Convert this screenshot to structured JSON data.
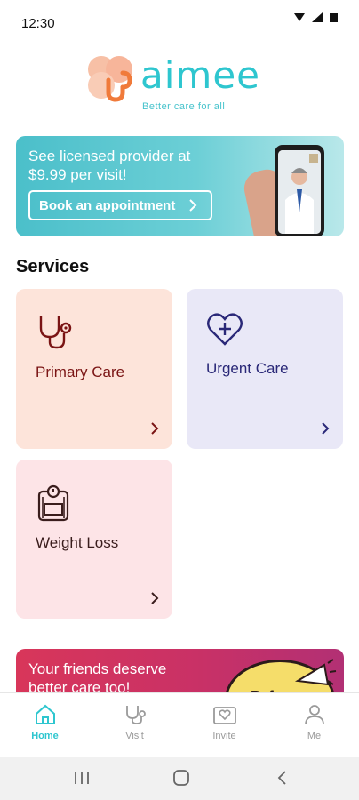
{
  "status_bar": {
    "time": "12:30"
  },
  "brand": {
    "name": "aimee",
    "tagline": "Better care for all",
    "accent": "#2ec6cf",
    "logo_color": "#f2864a"
  },
  "promo": {
    "text": "See licensed provider at $9.99 per visit!",
    "button_label": "Book an appointment"
  },
  "services": {
    "title": "Services",
    "items": [
      {
        "label": "Primary Care",
        "icon": "stethoscope-icon"
      },
      {
        "label": "Urgent Care",
        "icon": "heart-plus-icon"
      },
      {
        "label": "Weight Loss",
        "icon": "scale-icon"
      }
    ]
  },
  "referral": {
    "text": "Your friends deserve better care too!",
    "badge": "Refer"
  },
  "bottom_nav": {
    "items": [
      {
        "label": "Home",
        "icon": "home-icon",
        "active": true
      },
      {
        "label": "Visit",
        "icon": "stethoscope-icon"
      },
      {
        "label": "Invite",
        "icon": "invite-icon"
      },
      {
        "label": "Me",
        "icon": "person-icon"
      }
    ]
  }
}
